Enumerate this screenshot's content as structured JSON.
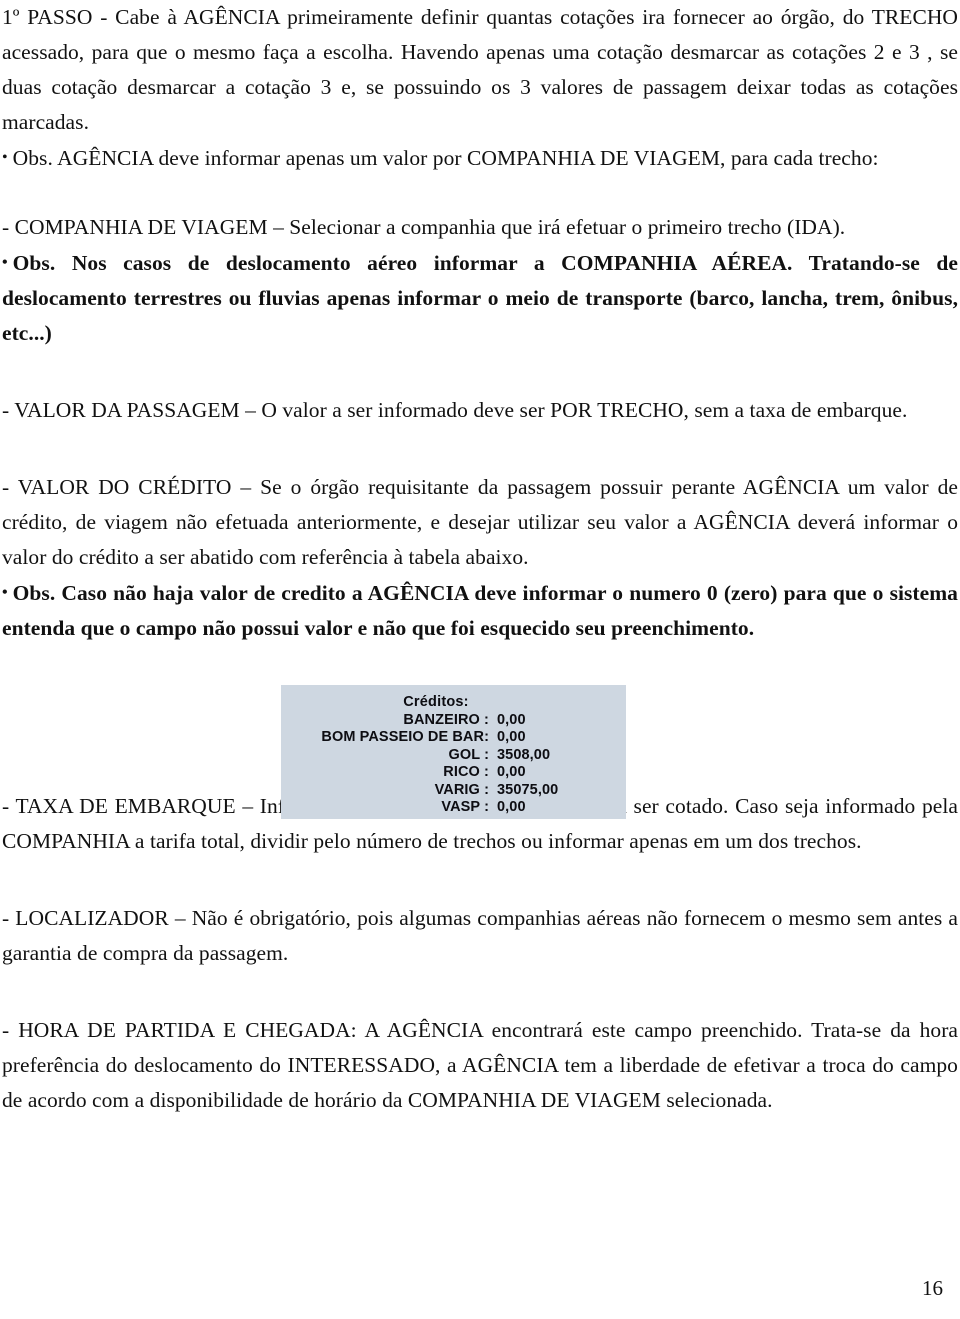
{
  "document": {
    "page_number": "16",
    "figure_bg_color": "#ced7e1",
    "text_color": "#111111"
  },
  "body": {
    "p1": "1º PASSO - Cabe à AGÊNCIA primeiramente definir quantas cotações ira fornecer ao órgão, do TRECHO acessado, para que o mesmo faça a escolha. Havendo apenas uma cotação desmarcar as cotações 2 e 3 , se duas cotação desmarcar a cotação 3 e, se possuindo os 3 valores de passagem deixar todas as cotações marcadas.",
    "p2_bullet": "•",
    "p2": "Obs. AGÊNCIA deve informar apenas um valor por COMPANHIA DE VIAGEM, para cada trecho:",
    "p3": "- COMPANHIA DE VIAGEM – Selecionar a companhia que irá efetuar o primeiro trecho (IDA).",
    "p4_bullet": "•",
    "p4": "Obs. Nos casos de deslocamento aéreo informar a COMPANHIA AÉREA. Tratando-se de deslocamento terrestres ou fluvias apenas informar o meio de transporte (barco, lancha, trem, ônibus, etc...)",
    "p5": "- VALOR DA PASSAGEM – O valor a ser informado deve ser POR TRECHO, sem a taxa de embarque.",
    "p6": "- VALOR DO CRÉDITO – Se o órgão requisitante da passagem possuir perante AGÊNCIA um valor de crédito, de viagem não efetuada anteriormente, e desejar utilizar seu valor a AGÊNCIA deverá informar o valor do crédito a ser abatido com referência à tabela abaixo.",
    "p7_bullet": "•",
    "p7": "Obs. Caso não haja valor de credito a AGÊNCIA deve informar o numero 0 (zero) para que o sistema entenda que o campo não possui valor e não que foi esquecido seu preenchimento.",
    "p8": "- TAXA DE EMBARQUE – Informar a taxa de embarque por trecho a ser cotado. Caso seja informado pela COMPANHIA a tarifa total, dividir pelo número de trechos ou informar apenas em um dos trechos.",
    "p9": "- LOCALIZADOR – Não é obrigatório, pois algumas companhias aéreas não fornecem o mesmo sem antes a garantia de compra da passagem.",
    "p10": "- HORA DE PARTIDA E CHEGADA: A AGÊNCIA encontrará este campo preenchido. Trata-se da hora preferência do deslocamento do INTERESSADO, a AGÊNCIA tem a liberdade de efetivar a troca do campo de acordo com a disponibilidade de horário da COMPANHIA DE VIAGEM selecionada."
  },
  "credits_figure": {
    "title": "Créditos:",
    "rows": [
      {
        "label": "BANZEIRO :",
        "value": "0,00"
      },
      {
        "label": "BOM PASSEIO DE BAR:",
        "value": "0,00"
      },
      {
        "label": "GOL :",
        "value": "3508,00"
      },
      {
        "label": "RICO :",
        "value": "0,00"
      },
      {
        "label": "VARIG :",
        "value": "35075,00"
      },
      {
        "label": "VASP :",
        "value": "0,00"
      }
    ]
  }
}
